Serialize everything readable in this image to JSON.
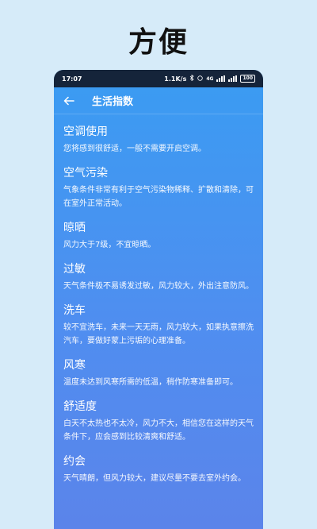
{
  "promo_title": "方便",
  "status_bar": {
    "time": "17:07",
    "network_speed": "1.1K/s",
    "network_type": "4G",
    "battery": "100"
  },
  "header": {
    "title": "生活指数"
  },
  "indices": [
    {
      "title": "空调使用",
      "desc": "您将感到很舒适，一般不需要开启空调。"
    },
    {
      "title": "空气污染",
      "desc": "气象条件非常有利于空气污染物稀释、扩散和清除，可在室外正常活动。"
    },
    {
      "title": "晾晒",
      "desc": "风力大于7级，不宜晾晒。"
    },
    {
      "title": "过敏",
      "desc": "天气条件极不易诱发过敏，风力较大，外出注意防风。"
    },
    {
      "title": "洗车",
      "desc": "较不宜洗车，未来一天无雨，风力较大，如果执意擦洗汽车，要做好蒙上污垢的心理准备。"
    },
    {
      "title": "风寒",
      "desc": "温度未达到风寒所需的低温，稍作防寒准备即可。"
    },
    {
      "title": "舒适度",
      "desc": "白天不太热也不太冷，风力不大，相信您在这样的天气条件下，应会感到比较清爽和舒适。"
    },
    {
      "title": "约会",
      "desc": "天气晴朗，但风力较大，建议尽量不要去室外约会。"
    }
  ],
  "colors": {
    "background": "#d6ebf9",
    "status_bar": "#15243a",
    "gradient_top": "#3a9cf2",
    "gradient_bottom": "#5b84ea"
  }
}
